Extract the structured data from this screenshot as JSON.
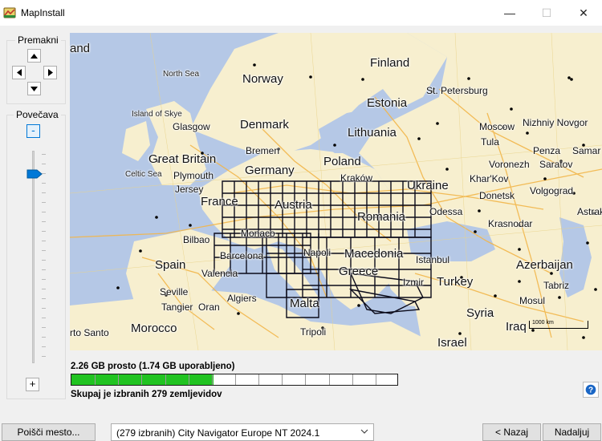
{
  "window": {
    "title": "MapInstall",
    "minimize_symbol": "—",
    "maximize_symbol": "☐",
    "close_symbol": "✕"
  },
  "pan": {
    "label": "Premakni",
    "up_icon": "arrow-up-icon",
    "down_icon": "arrow-down-icon",
    "left_icon": "arrow-left-icon",
    "right_icon": "arrow-right-icon"
  },
  "zoom": {
    "label": "Povečava",
    "minus": "-",
    "plus": "+"
  },
  "map": {
    "countries": [
      {
        "name": "Finland"
      },
      {
        "name": "Norway"
      },
      {
        "name": "Estonia"
      },
      {
        "name": "Denmark"
      },
      {
        "name": "Lithuania"
      },
      {
        "name": "Poland"
      },
      {
        "name": "Great Britain"
      },
      {
        "name": "Germany"
      },
      {
        "name": "France"
      },
      {
        "name": "Ukraine"
      },
      {
        "name": "Romania"
      },
      {
        "name": "Spain"
      },
      {
        "name": "Greece"
      },
      {
        "name": "Turkey"
      },
      {
        "name": "Azerbaijan"
      },
      {
        "name": "Syria"
      },
      {
        "name": "Morocco"
      },
      {
        "name": "Malta"
      },
      {
        "name": "Israel"
      },
      {
        "name": "Iraq"
      },
      {
        "name": "and"
      },
      {
        "name": "Macedonia"
      },
      {
        "name": "Austria"
      }
    ],
    "cities": [
      {
        "name": "St. Petersburg"
      },
      {
        "name": "Moscow"
      },
      {
        "name": "Nizhniy Novgor"
      },
      {
        "name": "Glasgow"
      },
      {
        "name": "Tula"
      },
      {
        "name": "Bremen"
      },
      {
        "name": "Penza"
      },
      {
        "name": "Samar"
      },
      {
        "name": "Voronezh"
      },
      {
        "name": "Saratov"
      },
      {
        "name": "Plymouth"
      },
      {
        "name": "Kraków"
      },
      {
        "name": "Khar'Kov"
      },
      {
        "name": "Jersey"
      },
      {
        "name": "Donetsk"
      },
      {
        "name": "Volgograd"
      },
      {
        "name": "Odessa"
      },
      {
        "name": "Astrakha"
      },
      {
        "name": "Krasnodar"
      },
      {
        "name": "Bilbao"
      },
      {
        "name": "Barcelona"
      },
      {
        "name": "Istanbul"
      },
      {
        "name": "Valencia"
      },
      {
        "name": "Izmir"
      },
      {
        "name": "Tabriz"
      },
      {
        "name": "Seville"
      },
      {
        "name": "Mosul"
      },
      {
        "name": "Algiers"
      },
      {
        "name": "Tangier"
      },
      {
        "name": "Oran"
      },
      {
        "name": "Tripoli"
      },
      {
        "name": "rto Santo"
      },
      {
        "name": "Monaco"
      },
      {
        "name": "Napoli"
      }
    ],
    "seas": [
      {
        "name": "North Sea"
      },
      {
        "name": "Island of Skye"
      },
      {
        "name": "Celtic Sea"
      }
    ],
    "scale_label": "1000 km"
  },
  "status": {
    "space_text": "2.26 GB prosto (1.74 GB uporabljeno)",
    "progress_fraction": 0.435,
    "total_text": "Skupaj je izbranih 279 zemljevidov",
    "help_icon": "help-icon"
  },
  "footer": {
    "find_place_button": "Poišči mesto...",
    "map_select_value": "(279 izbranih) City Navigator Europe NT 2024.1",
    "back_button": "< Nazaj",
    "next_button": "Nadaljuj"
  },
  "colors": {
    "sea": "#b5c8e6",
    "land": "#f7efcf",
    "road": "#f2b64a",
    "selected_tile_border": "#0b0b1a",
    "progress_fill": "#21c321",
    "accent": "#0078d7"
  }
}
